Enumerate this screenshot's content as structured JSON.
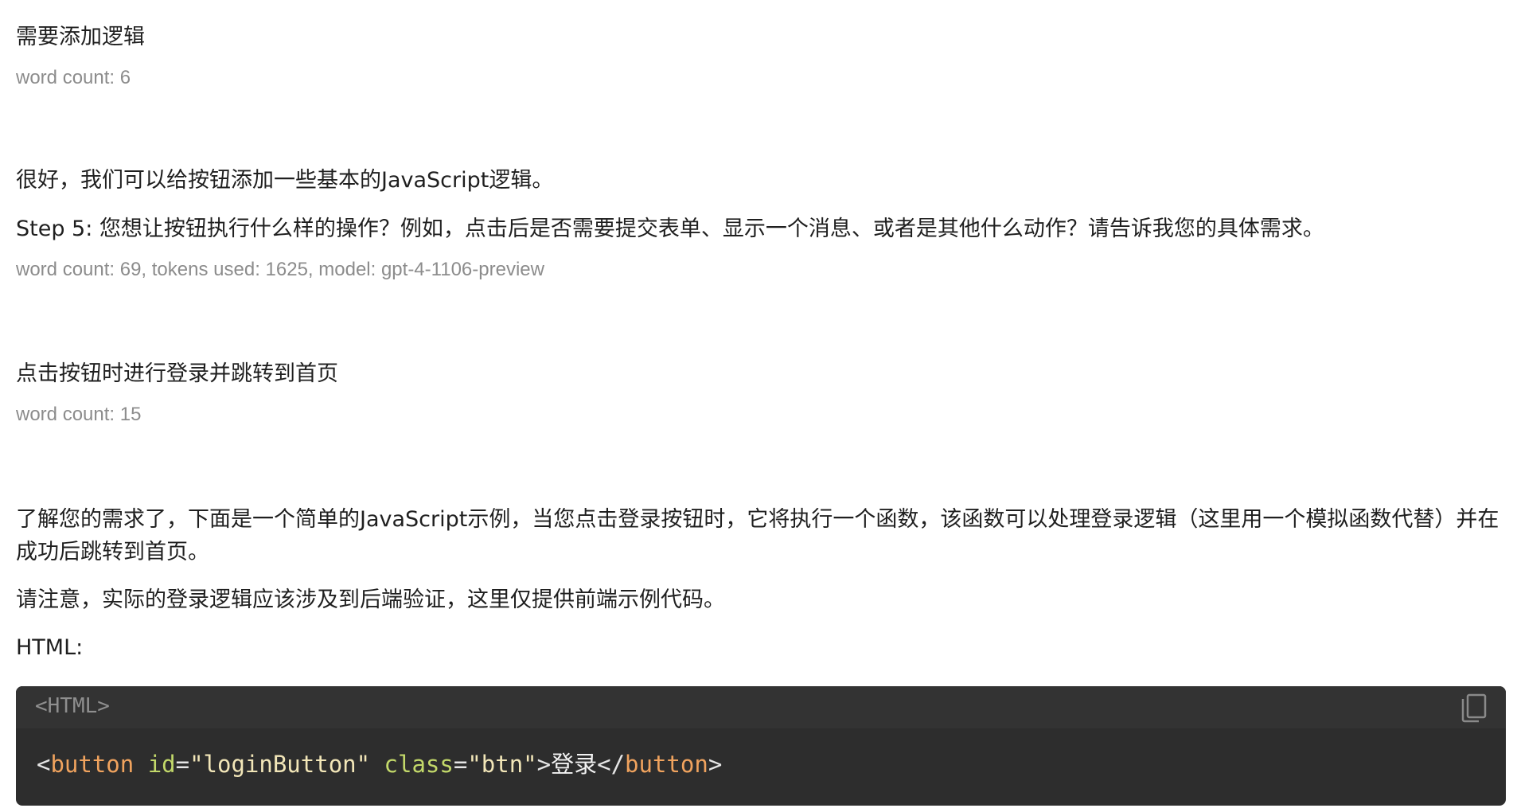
{
  "messages": [
    {
      "role": "user",
      "text": "需要添加逻辑",
      "meta": "word count: 6"
    },
    {
      "role": "assistant",
      "paragraphs": [
        "很好，我们可以给按钮添加一些基本的JavaScript逻辑。",
        "Step 5: 您想让按钮执行什么样的操作？例如，点击后是否需要提交表单、显示一个消息、或者是其他什么动作？请告诉我您的具体需求。"
      ],
      "meta": "word count: 69, tokens used: 1625, model: gpt-4-1106-preview"
    },
    {
      "role": "user",
      "text": "点击按钮时进行登录并跳转到首页",
      "meta": "word count: 15"
    },
    {
      "role": "assistant",
      "paragraphs": [
        "了解您的需求了，下面是一个简单的JavaScript示例，当您点击登录按钮时，它将执行一个函数，该函数可以处理登录逻辑（这里用一个模拟函数代替）并在成功后跳转到首页。",
        "请注意，实际的登录逻辑应该涉及到后端验证，这里仅提供前端示例代码。",
        "HTML:"
      ]
    }
  ],
  "code_block": {
    "language_label": "<HTML>",
    "copy_icon": "copy-icon",
    "tokens": {
      "lt": "<",
      "tag_open": "button",
      "sp1": " ",
      "attr1": "id",
      "eq1": "=",
      "val1": "\"loginButton\"",
      "sp2": " ",
      "attr2": "class",
      "eq2": "=",
      "val2": "\"btn\"",
      "gt": ">",
      "inner": "登录",
      "lt_close": "</",
      "tag_close": "button",
      "gt_close": ">"
    },
    "colors": {
      "background": "#2d2d2d",
      "header": "#333333",
      "tag": "#f0a35e",
      "attr": "#c3d96a",
      "string": "#f2e6b8"
    }
  }
}
